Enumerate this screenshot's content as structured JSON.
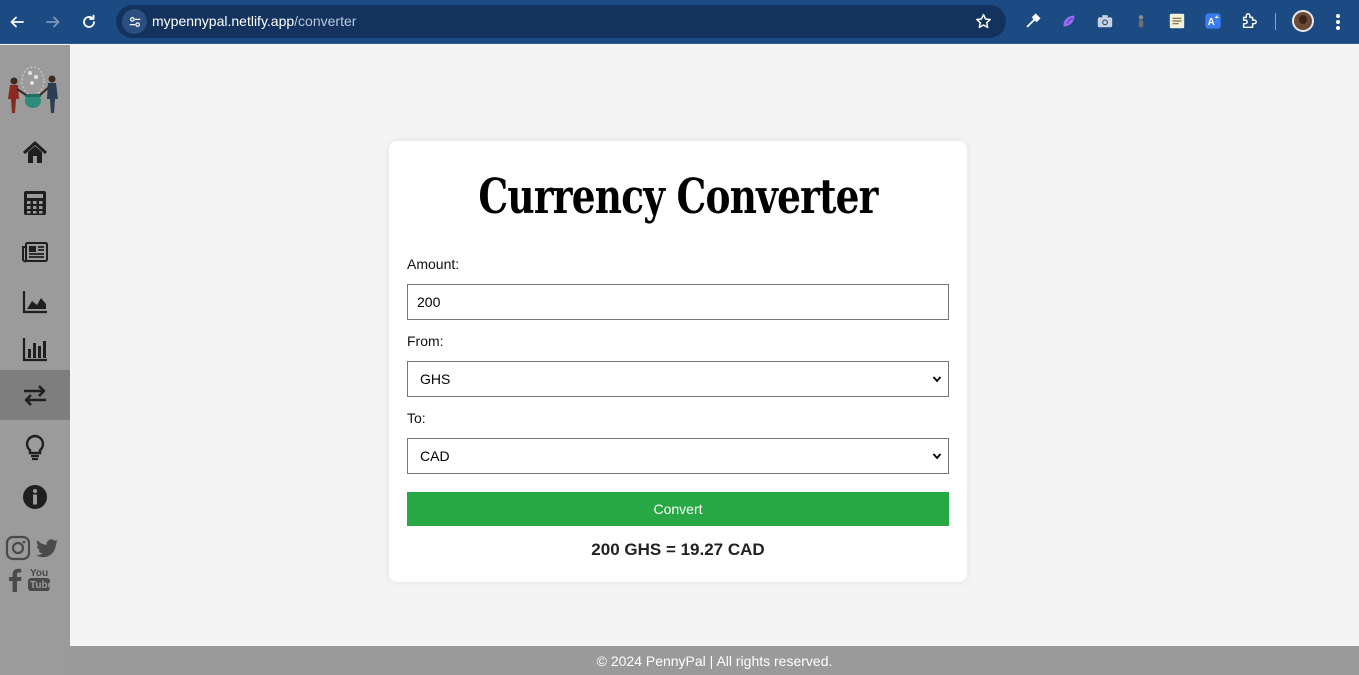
{
  "browser": {
    "url_host": "mypennypal.netlify.app",
    "url_path": "/converter",
    "icons": [
      "back-arrow-icon",
      "forward-arrow-icon",
      "reload-icon",
      "site-info-icon",
      "bookmark-star-icon",
      "eyedropper-icon",
      "extension-icon",
      "camera-icon",
      "extension-icon",
      "sheets-icon",
      "translate-icon",
      "puzzle-icon",
      "profile-avatar",
      "kebab-menu-icon"
    ]
  },
  "sidebar": {
    "items": [
      {
        "name": "home",
        "icon": "home-icon"
      },
      {
        "name": "calculator",
        "icon": "calculator-icon"
      },
      {
        "name": "news",
        "icon": "newspaper-icon"
      },
      {
        "name": "area-chart",
        "icon": "area-chart-icon"
      },
      {
        "name": "bar-chart",
        "icon": "bar-chart-icon"
      },
      {
        "name": "converter",
        "icon": "exchange-arrows-icon",
        "active": true
      },
      {
        "name": "tips",
        "icon": "lightbulb-icon"
      },
      {
        "name": "about",
        "icon": "info-icon"
      }
    ],
    "social": [
      "instagram-icon",
      "twitter-icon",
      "facebook-icon",
      "youtube-icon"
    ],
    "accent": "#7e7e7e",
    "background": "#9b9b9b"
  },
  "converter": {
    "title": "Currency Converter",
    "amount_label": "Amount:",
    "amount_value": "200",
    "from_label": "From:",
    "from_value": "GHS",
    "to_label": "To:",
    "to_value": "CAD",
    "convert_label": "Convert",
    "convert_color": "#28a745",
    "result": "200 GHS = 19.27 CAD"
  },
  "footer": {
    "text": "© 2024 PennyPal | All rights reserved."
  }
}
